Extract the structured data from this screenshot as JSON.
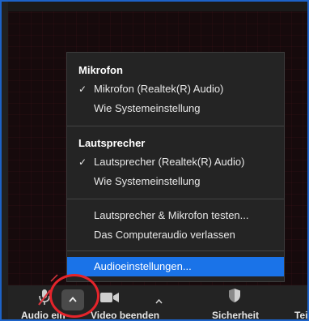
{
  "audio_menu": {
    "microphone_title": "Mikrofon",
    "microphone_items": [
      {
        "label": "Mikrofon (Realtek(R) Audio)",
        "checked": true
      },
      {
        "label": "Wie Systemeinstellung",
        "checked": false
      }
    ],
    "speaker_title": "Lautsprecher",
    "speaker_items": [
      {
        "label": "Lautsprecher (Realtek(R) Audio)",
        "checked": true
      },
      {
        "label": "Wie Systemeinstellung",
        "checked": false
      }
    ],
    "actions": [
      {
        "label": "Lautsprecher & Mikrofon testen..."
      },
      {
        "label": "Das Computeraudio verlassen"
      }
    ],
    "settings_item": "Audioeinstellungen..."
  },
  "toolbar": {
    "audio_label": "Audio ein",
    "video_label": "Video beenden",
    "security_label": "Sicherheit",
    "participants_label_partial": "Tei"
  },
  "icons": {
    "check": "check-icon",
    "caret": "caret-up-icon",
    "mic": "microphone-muted-icon",
    "camera": "video-camera-icon",
    "shield": "shield-icon"
  },
  "colors": {
    "menu_bg": "#242424",
    "selected": "#1a73e8",
    "highlight_ring": "#e5242b",
    "mute_red": "#d9363e"
  }
}
